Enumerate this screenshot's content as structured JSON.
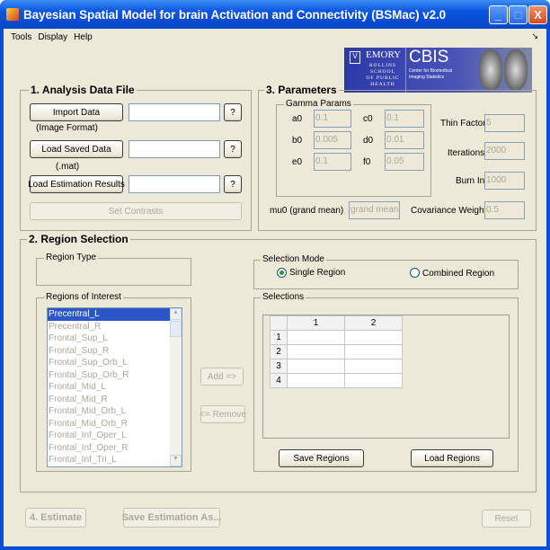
{
  "window": {
    "title": "Bayesian Spatial  Model for brain Activation and Connectivity (BSMac) v2.0",
    "controls": [
      "_",
      "□",
      "X"
    ]
  },
  "menu": [
    "Tools",
    "Display",
    "Help"
  ],
  "logo": {
    "emory": "EMORY",
    "rollins": "ROLLINS SCHOOL OF PUBLIC HEALTH",
    "cbis": "CBIS",
    "cbis_sub": "Center for Biomedical Imaging Statistics"
  },
  "section1": {
    "title": "1. Analysis Data File",
    "import_btn": "Import Data",
    "import_note": "(Image Format)",
    "load_btn": "Load Saved Data",
    "load_note": "(.mat)",
    "load_results_btn": "Load Estimation Results",
    "help": "?",
    "set_contrasts": "Set Contrasts"
  },
  "section3": {
    "title": "3. Parameters",
    "gamma_title": "Gamma Params",
    "gamma": [
      {
        "label": "a0",
        "value": "0.1"
      },
      {
        "label": "c0",
        "value": "0.1"
      },
      {
        "label": "b0",
        "value": "0.005"
      },
      {
        "label": "d0",
        "value": "0.01"
      },
      {
        "label": "e0",
        "value": "0.1"
      },
      {
        "label": "f0",
        "value": "0.05"
      }
    ],
    "thin_label": "Thin Factor:",
    "thin": "5",
    "iter_label": "Iterations:",
    "iter": "2000",
    "burn_label": "Burn In:",
    "burn": "1000",
    "mu0_label": "mu0 (grand mean)",
    "mu0": "grand mean",
    "cov_label": "Covariance Weight:",
    "cov": "0.5"
  },
  "section2": {
    "title": "2. Region Selection",
    "region_type": "Region Type",
    "roi_title": "Regions of Interest",
    "regions": [
      "Precentral_L",
      "Precentral_R",
      "Frontal_Sup_L",
      "Frontal_Sup_R",
      "Frontal_Sup_Orb_L",
      "Frontal_Sup_Orb_R",
      "Frontal_Mid_L",
      "Frontal_Mid_R",
      "Frontal_Mid_Orb_L",
      "Frontal_Mid_Orb_R",
      "Frontal_Inf_Oper_L",
      "Frontal_Inf_Oper_R",
      "Frontal_Inf_Tri_L"
    ],
    "add": "Add =>",
    "remove": "<= Remove",
    "mode_title": "Selection Mode",
    "single": "Single Region",
    "combined": "Combined Region",
    "selections_title": "Selections",
    "cols": [
      "1",
      "2"
    ],
    "rows": [
      "1",
      "2",
      "3",
      "4"
    ],
    "save": "Save Regions",
    "load": "Load Regions"
  },
  "bottom": {
    "estimate": "4. Estimate",
    "save_as": "Save Estimation As...",
    "reset": "Reset"
  }
}
